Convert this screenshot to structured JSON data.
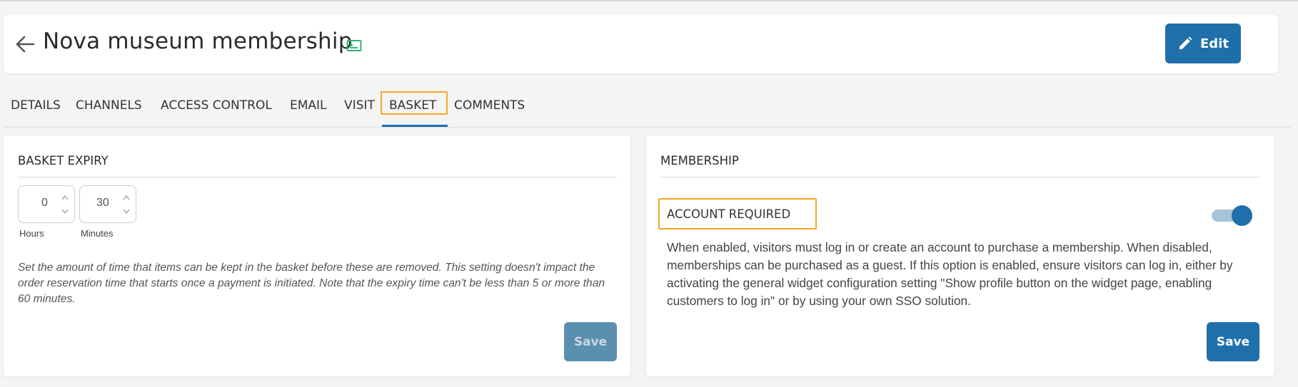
{
  "header": {
    "title": "Nova museum membership",
    "back_icon": "arrow-left-icon",
    "badge_icon": "ticket-card-icon",
    "edit_label": "Edit",
    "edit_icon": "pencil-icon"
  },
  "tabs": [
    {
      "label": "DETAILS"
    },
    {
      "label": "CHANNELS"
    },
    {
      "label": "ACCESS CONTROL"
    },
    {
      "label": "EMAIL"
    },
    {
      "label": "VISIT"
    },
    {
      "label": "BASKET",
      "active": true
    },
    {
      "label": "COMMENTS"
    }
  ],
  "basket_expiry": {
    "heading": "BASKET EXPIRY",
    "hours_value": "0",
    "minutes_value": "30",
    "hours_label": "Hours",
    "minutes_label": "Minutes",
    "help_text": "Set the amount of time that items can be kept in the basket before these are removed. This setting doesn't impact the order reservation time that starts once a payment is initiated. Note that the expiry time can't be less than 5 or more than 60 minutes.",
    "save_label": "Save"
  },
  "membership": {
    "heading": "MEMBERSHIP",
    "account_required_label": "ACCOUNT REQUIRED",
    "account_required_enabled": true,
    "description": "When enabled, visitors must log in or create an account to purchase a membership. When disabled, memberships can be purchased as a guest. If this option is enabled, ensure visitors can log in, either by activating the general widget configuration setting \"Show profile button on the widget page, enabling customers to log in\" or by using your own SSO solution.",
    "save_label": "Save"
  },
  "colors": {
    "primary": "#1f6fab",
    "highlight_outline": "#f5a623",
    "badge_green": "#2bb673",
    "background": "#f4f4f4"
  }
}
